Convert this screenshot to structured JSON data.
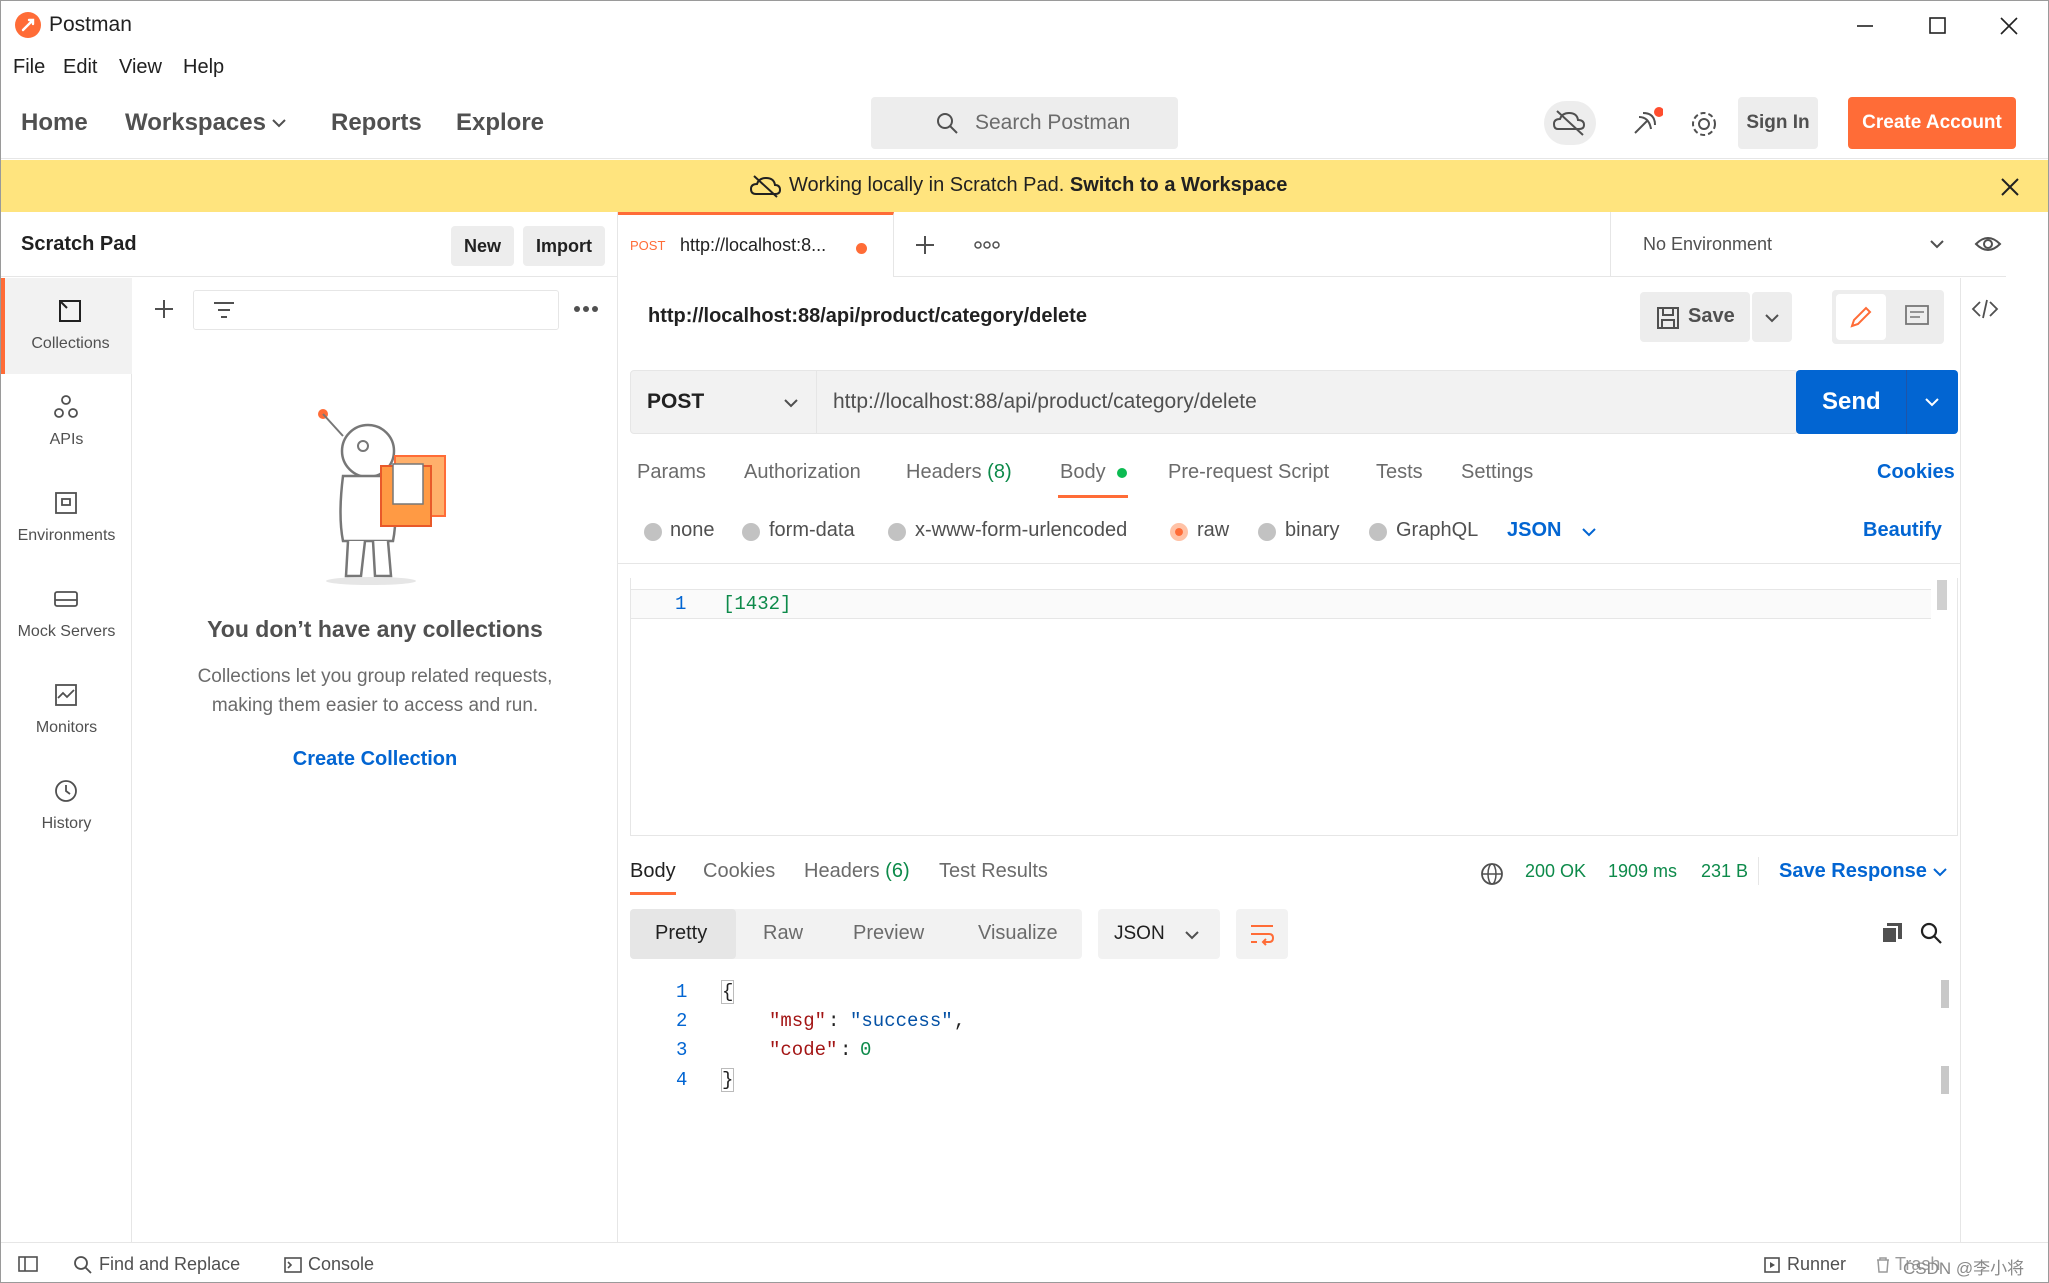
{
  "window": {
    "title": "Postman"
  },
  "menu": [
    "File",
    "Edit",
    "View",
    "Help"
  ],
  "header": {
    "nav": [
      "Home",
      "Workspaces",
      "Reports",
      "Explore"
    ],
    "search_placeholder": "Search Postman",
    "signin_label": "Sign In",
    "create_account_label": "Create Account"
  },
  "banner": {
    "text": "Working locally in Scratch Pad.",
    "link": "Switch to a Workspace"
  },
  "sidebar": {
    "title": "Scratch Pad",
    "new_label": "New",
    "import_label": "Import",
    "rail": [
      "Collections",
      "APIs",
      "Environments",
      "Mock Servers",
      "Monitors",
      "History"
    ],
    "empty_title": "You don’t have any collections",
    "empty_line1": "Collections let you group related requests,",
    "empty_line2": "making them easier to access and run.",
    "create_collection": "Create Collection"
  },
  "tab": {
    "method": "POST",
    "url": "http://localhost:8..."
  },
  "environment": "No Environment",
  "request": {
    "name": "http://localhost:88/api/product/category/delete",
    "save_label": "Save",
    "method": "POST",
    "url": "http://localhost:88/api/product/category/delete",
    "send_label": "Send",
    "tabs": {
      "params": "Params",
      "authorization": "Authorization",
      "headers_label": "Headers",
      "headers_count": "(8)",
      "body": "Body",
      "prerequest": "Pre-request Script",
      "tests": "Tests",
      "settings": "Settings"
    },
    "cookies_label": "Cookies",
    "body_options": [
      "none",
      "form-data",
      "x-www-form-urlencoded",
      "raw",
      "binary",
      "GraphQL"
    ],
    "body_format": "JSON",
    "beautify_label": "Beautify",
    "body_line_no": "1",
    "body_text": "[1432]"
  },
  "response": {
    "tabs": {
      "body": "Body",
      "cookies": "Cookies",
      "headers_label": "Headers",
      "headers_count": "(6)",
      "test_results": "Test Results"
    },
    "status": "200 OK",
    "time": "1909 ms",
    "size": "231 B",
    "save_response": "Save Response",
    "views": [
      "Pretty",
      "Raw",
      "Preview",
      "Visualize"
    ],
    "format": "JSON",
    "line_numbers": [
      "1",
      "2",
      "3",
      "4"
    ],
    "lines": {
      "open": "{",
      "msg_key": "\"msg\"",
      "msg_val": "\"success\"",
      "code_key": "\"code\"",
      "code_val": "0",
      "close": "}"
    }
  },
  "statusbar": {
    "find_replace": "Find and Replace",
    "console": "Console",
    "runner": "Runner",
    "trash": "Trash",
    "watermark": "CSDN @李小将"
  },
  "colors": {
    "brand": "#ff6c37",
    "accent_blue": "#0265d2",
    "banner_bg": "#ffe47e",
    "success_green": "#0d8a4a"
  }
}
